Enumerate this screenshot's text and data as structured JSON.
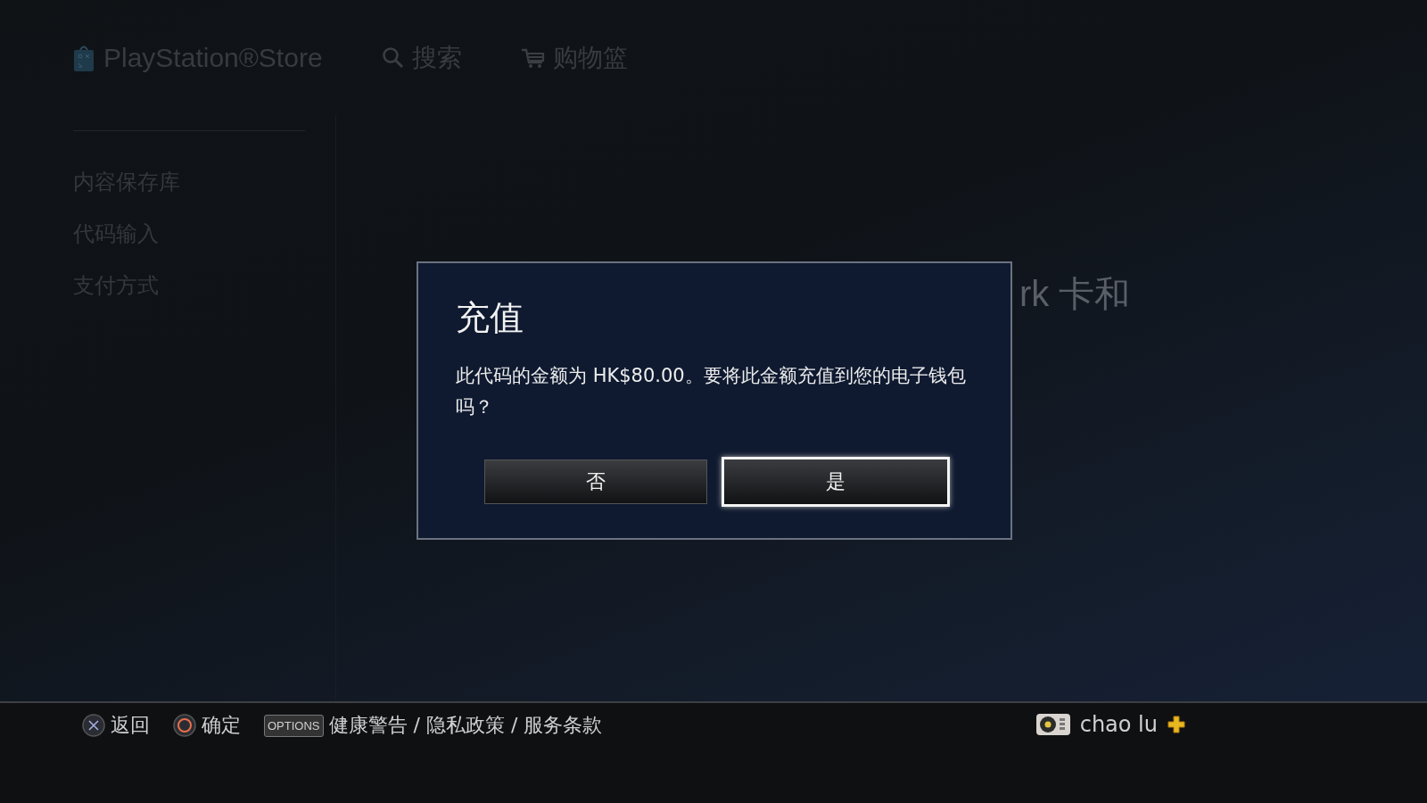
{
  "header": {
    "store_name": "PlayStation®Store",
    "nav": [
      {
        "kind": "search",
        "label": "搜索"
      },
      {
        "kind": "cart",
        "label": "购物篮"
      }
    ]
  },
  "sidebar": {
    "items": [
      {
        "label": "内容保存库"
      },
      {
        "label": "代码输入"
      },
      {
        "label": "支付方式"
      }
    ]
  },
  "page": {
    "heading_lines": [
      "rk 卡和"
    ]
  },
  "dialog": {
    "title": "充值",
    "message": "此代码的金额为 HK$80.00。要将此金额充值到您的电子钱包吗？",
    "buttons": [
      {
        "label": "否",
        "selected": false
      },
      {
        "label": "是",
        "selected": true
      }
    ]
  },
  "footer": {
    "hints": [
      {
        "kind": "cross",
        "label": "返回"
      },
      {
        "kind": "circle",
        "label": "确定"
      },
      {
        "kind": "options",
        "badge": "OPTIONS",
        "label": "健康警告 / 隐私政策 / 服务条款"
      }
    ],
    "user": {
      "name": "chao lu",
      "plus": true
    }
  }
}
